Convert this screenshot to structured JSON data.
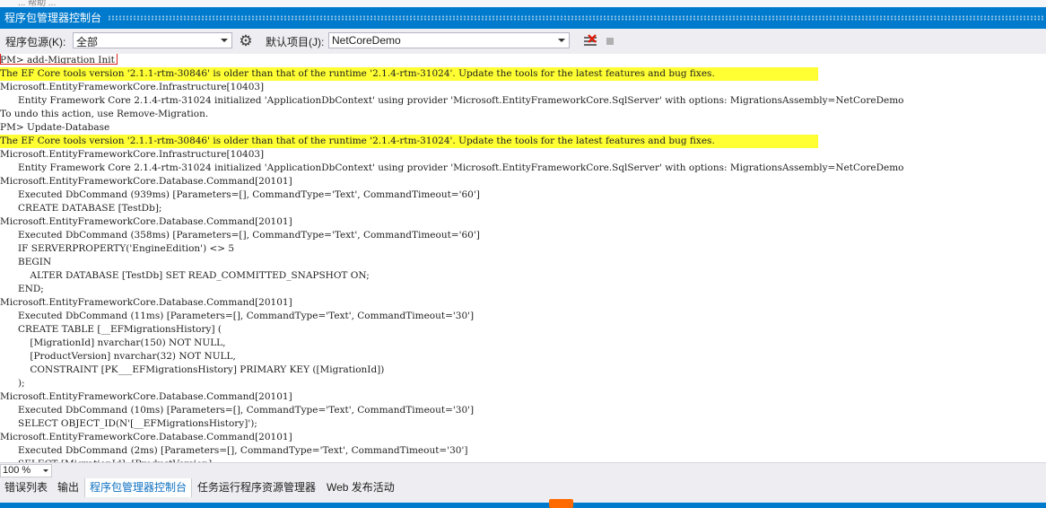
{
  "window": {
    "title": "程序包管理器控制台",
    "top_strip_text": "...  帮助  ..."
  },
  "toolbar": {
    "source_label": "程序包源(K):",
    "source_value": "全部",
    "default_project_label": "默认项目(J):",
    "default_project_value": "NetCoreDemo",
    "settings_icon": "gear-icon",
    "clear_icon": "clear-console-icon",
    "stop_icon": "stop-icon"
  },
  "console": {
    "lines": [
      {
        "text": "PM> add-Migration Init",
        "warn": false
      },
      {
        "text": "The EF Core tools version '2.1.1-rtm-30846' is older than that of the runtime '2.1.4-rtm-31024'. Update the tools for the latest features and bug fixes.",
        "warn": true
      },
      {
        "text": "Microsoft.EntityFrameworkCore.Infrastructure[10403]",
        "warn": false
      },
      {
        "text": "      Entity Framework Core 2.1.4-rtm-31024 initialized 'ApplicationDbContext' using provider 'Microsoft.EntityFrameworkCore.SqlServer' with options: MigrationsAssembly=NetCoreDemo",
        "warn": false
      },
      {
        "text": "To undo this action, use Remove-Migration.",
        "warn": false
      },
      {
        "text": "PM> Update-Database",
        "warn": false
      },
      {
        "text": "The EF Core tools version '2.1.1-rtm-30846' is older than that of the runtime '2.1.4-rtm-31024'. Update the tools for the latest features and bug fixes.",
        "warn": true
      },
      {
        "text": "Microsoft.EntityFrameworkCore.Infrastructure[10403]",
        "warn": false
      },
      {
        "text": "      Entity Framework Core 2.1.4-rtm-31024 initialized 'ApplicationDbContext' using provider 'Microsoft.EntityFrameworkCore.SqlServer' with options: MigrationsAssembly=NetCoreDemo",
        "warn": false
      },
      {
        "text": "Microsoft.EntityFrameworkCore.Database.Command[20101]",
        "warn": false
      },
      {
        "text": "      Executed DbCommand (939ms) [Parameters=[], CommandType='Text', CommandTimeout='60']",
        "warn": false
      },
      {
        "text": "      CREATE DATABASE [TestDb];",
        "warn": false
      },
      {
        "text": "Microsoft.EntityFrameworkCore.Database.Command[20101]",
        "warn": false
      },
      {
        "text": "      Executed DbCommand (358ms) [Parameters=[], CommandType='Text', CommandTimeout='60']",
        "warn": false
      },
      {
        "text": "      IF SERVERPROPERTY('EngineEdition') <> 5",
        "warn": false
      },
      {
        "text": "      BEGIN",
        "warn": false
      },
      {
        "text": "          ALTER DATABASE [TestDb] SET READ_COMMITTED_SNAPSHOT ON;",
        "warn": false
      },
      {
        "text": "      END;",
        "warn": false
      },
      {
        "text": "Microsoft.EntityFrameworkCore.Database.Command[20101]",
        "warn": false
      },
      {
        "text": "      Executed DbCommand (11ms) [Parameters=[], CommandType='Text', CommandTimeout='30']",
        "warn": false
      },
      {
        "text": "      CREATE TABLE [__EFMigrationsHistory] (",
        "warn": false
      },
      {
        "text": "          [MigrationId] nvarchar(150) NOT NULL,",
        "warn": false
      },
      {
        "text": "          [ProductVersion] nvarchar(32) NOT NULL,",
        "warn": false
      },
      {
        "text": "          CONSTRAINT [PK___EFMigrationsHistory] PRIMARY KEY ([MigrationId])",
        "warn": false
      },
      {
        "text": "      );",
        "warn": false
      },
      {
        "text": "Microsoft.EntityFrameworkCore.Database.Command[20101]",
        "warn": false
      },
      {
        "text": "      Executed DbCommand (10ms) [Parameters=[], CommandType='Text', CommandTimeout='30']",
        "warn": false
      },
      {
        "text": "      SELECT OBJECT_ID(N'[__EFMigrationsHistory]');",
        "warn": false
      },
      {
        "text": "Microsoft.EntityFrameworkCore.Database.Command[20101]",
        "warn": false
      },
      {
        "text": "      Executed DbCommand (2ms) [Parameters=[], CommandType='Text', CommandTimeout='30']",
        "warn": false
      },
      {
        "text": "      SELECT [MigrationId], [ProductVersion]",
        "warn": false
      }
    ]
  },
  "zoom": {
    "value": "100 %"
  },
  "tabs": [
    {
      "label": "错误列表",
      "active": false
    },
    {
      "label": "输出",
      "active": false
    },
    {
      "label": "程序包管理器控制台",
      "active": true
    },
    {
      "label": "任务运行程序资源管理器",
      "active": false
    },
    {
      "label": "Web 发布活动",
      "active": false
    }
  ],
  "colors": {
    "accent": "#007acc",
    "warning_highlight": "#ffff33",
    "active_tab_text": "#0e70c0"
  }
}
